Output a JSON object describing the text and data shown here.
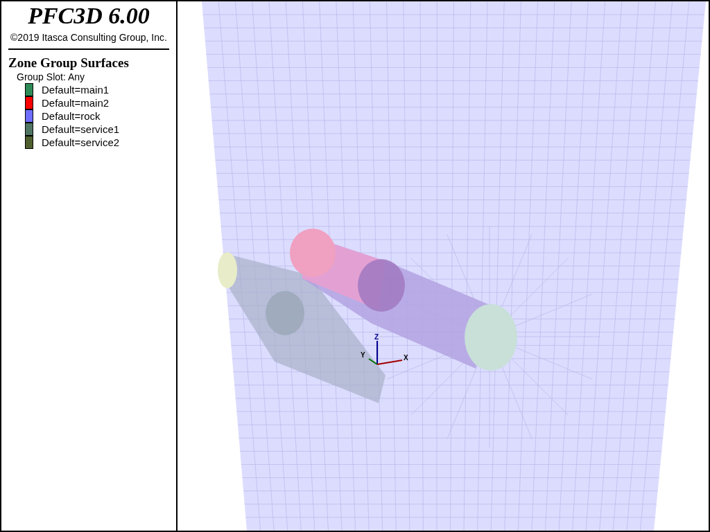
{
  "product": {
    "title": "PFC3D 6.00",
    "copyright": "©2019 Itasca Consulting Group, Inc."
  },
  "legend": {
    "title": "Zone Group Surfaces",
    "slot": "Group Slot: Any",
    "items": [
      {
        "label": "Default=main1",
        "color": "#2e8b57"
      },
      {
        "label": "Default=main2",
        "color": "#ff0000"
      },
      {
        "label": "Default=rock",
        "color": "#6e6eff"
      },
      {
        "label": "Default=service1",
        "color": "#4f7562"
      },
      {
        "label": "Default=service2",
        "color": "#4f5f2f"
      }
    ]
  },
  "axes": {
    "x": "X",
    "y": "Y",
    "z": "Z"
  }
}
